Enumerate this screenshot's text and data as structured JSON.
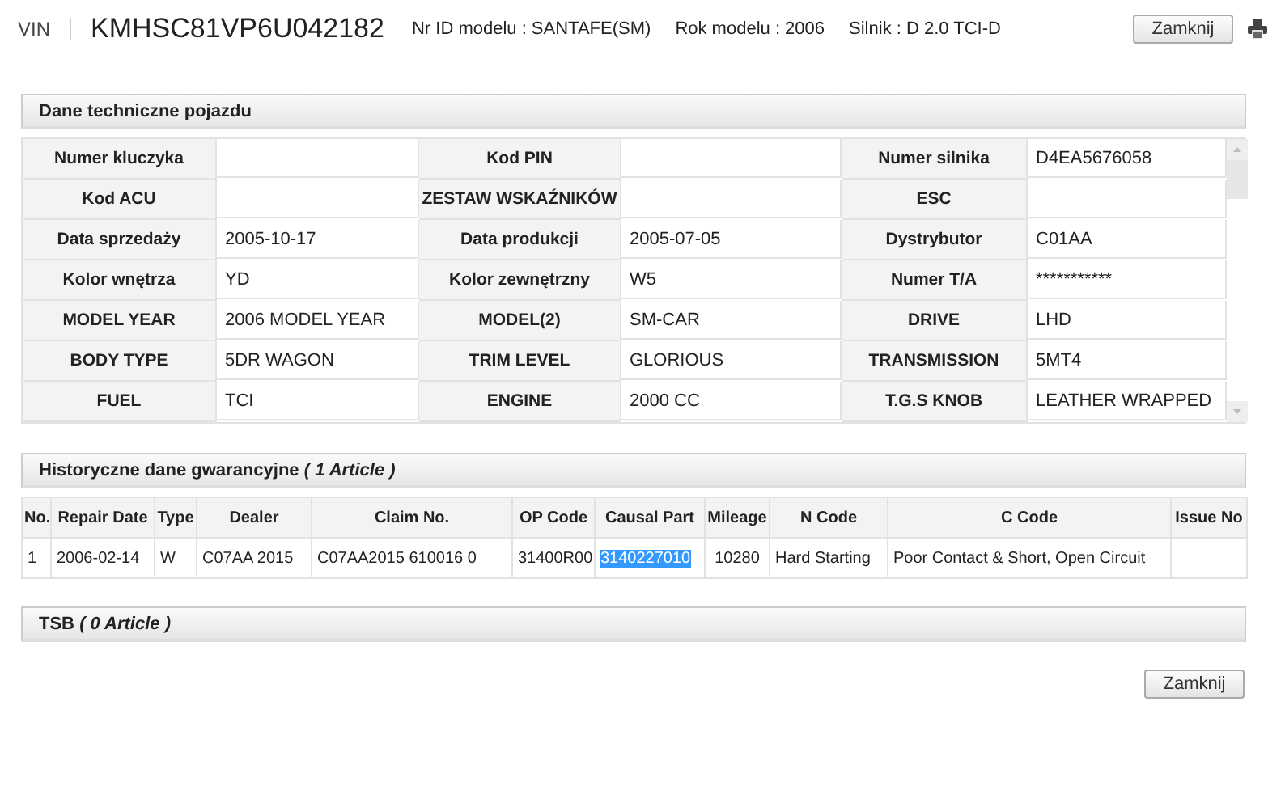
{
  "header": {
    "vin_label": "VIN",
    "vin": "KMHSC81VP6U042182",
    "model_id": "Nr ID modelu : SANTAFE(SM)",
    "model_year": "Rok modelu : 2006",
    "engine": "Silnik : D 2.0 TCI-D",
    "close_button": "Zamknij"
  },
  "vehicle_data": {
    "title": "Dane techniczne pojazdu",
    "fields": [
      {
        "label": "Numer kluczyka"
      },
      {
        "label": "Kod PIN"
      },
      {
        "label": "Numer silnika",
        "value": "D4EA5676058"
      },
      {
        "label": "Kod ACU"
      },
      {
        "label": "ZESTAW WSKAŹNIKÓW"
      },
      {
        "label": "ESC"
      },
      {
        "label": "Data sprzedaży",
        "value": "2005-10-17"
      },
      {
        "label": "Data produkcji",
        "value": "2005-07-05"
      },
      {
        "label": "Dystrybutor",
        "value": "C01AA"
      },
      {
        "label": "Kolor wnętrza",
        "value": "YD"
      },
      {
        "label": "Kolor zewnętrzny",
        "value": "W5"
      },
      {
        "label": "Numer T/A",
        "value": "***********"
      },
      {
        "label": "MODEL YEAR",
        "value": "2006 MODEL YEAR"
      },
      {
        "label": "MODEL(2)",
        "value": "SM-CAR"
      },
      {
        "label": "DRIVE",
        "value": "LHD"
      },
      {
        "label": "BODY TYPE",
        "value": "5DR WAGON"
      },
      {
        "label": "TRIM LEVEL",
        "value": "GLORIOUS"
      },
      {
        "label": "TRANSMISSION",
        "value": "5MT4"
      },
      {
        "label": "FUEL",
        "value": "TCI"
      },
      {
        "label": "ENGINE",
        "value": "2000 CC"
      },
      {
        "label": "T.G.S KNOB",
        "value": "LEATHER WRAPPED"
      }
    ]
  },
  "warranty": {
    "title": "Historyczne dane gwarancyjne *( 1 Article )*",
    "columns": [
      "No.",
      "Repair Date",
      "Type",
      "Dealer",
      "Claim No.",
      "OP Code",
      "Causal Part",
      "Mileage",
      "N Code",
      "C Code",
      "Issue No"
    ],
    "rows": [
      {
        "cells": [
          {
            "text": "1",
            "selected": false
          },
          {
            "text": "2006-02-14",
            "selected": false
          },
          {
            "text": "W",
            "selected": false
          },
          {
            "text": "C07AA 2015",
            "selected": false
          },
          {
            "text": "C07AA2015 610016 0",
            "selected": false
          },
          {
            "text": "31400R00",
            "selected": false
          },
          {
            "text": "3140227010",
            "selected": true
          },
          {
            "text": "10280",
            "selected": false
          },
          {
            "text": "Hard Starting",
            "selected": false
          },
          {
            "text": "Poor Contact & Short, Open Circuit",
            "selected": false
          }
        ]
      }
    ]
  },
  "tsb": {
    "title": "TSB *( 0 Article )*"
  },
  "footer": {
    "close_button": "Zamknij"
  }
}
